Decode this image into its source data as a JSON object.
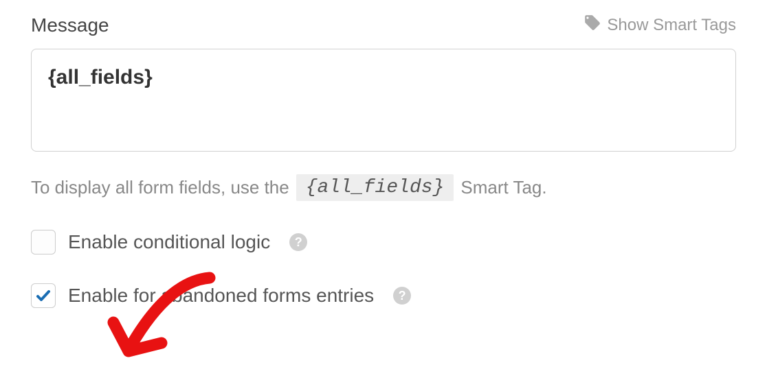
{
  "header": {
    "label": "Message",
    "smartTagsToggle": "Show Smart Tags"
  },
  "message": {
    "value": "{all_fields}"
  },
  "helper": {
    "prefix": "To display all form fields, use the",
    "code": "{all_fields}",
    "suffix": "Smart Tag."
  },
  "options": {
    "conditionalLogic": {
      "label": "Enable conditional logic",
      "checked": false
    },
    "abandonedForms": {
      "label": "Enable for abandoned forms entries",
      "checked": true
    }
  }
}
